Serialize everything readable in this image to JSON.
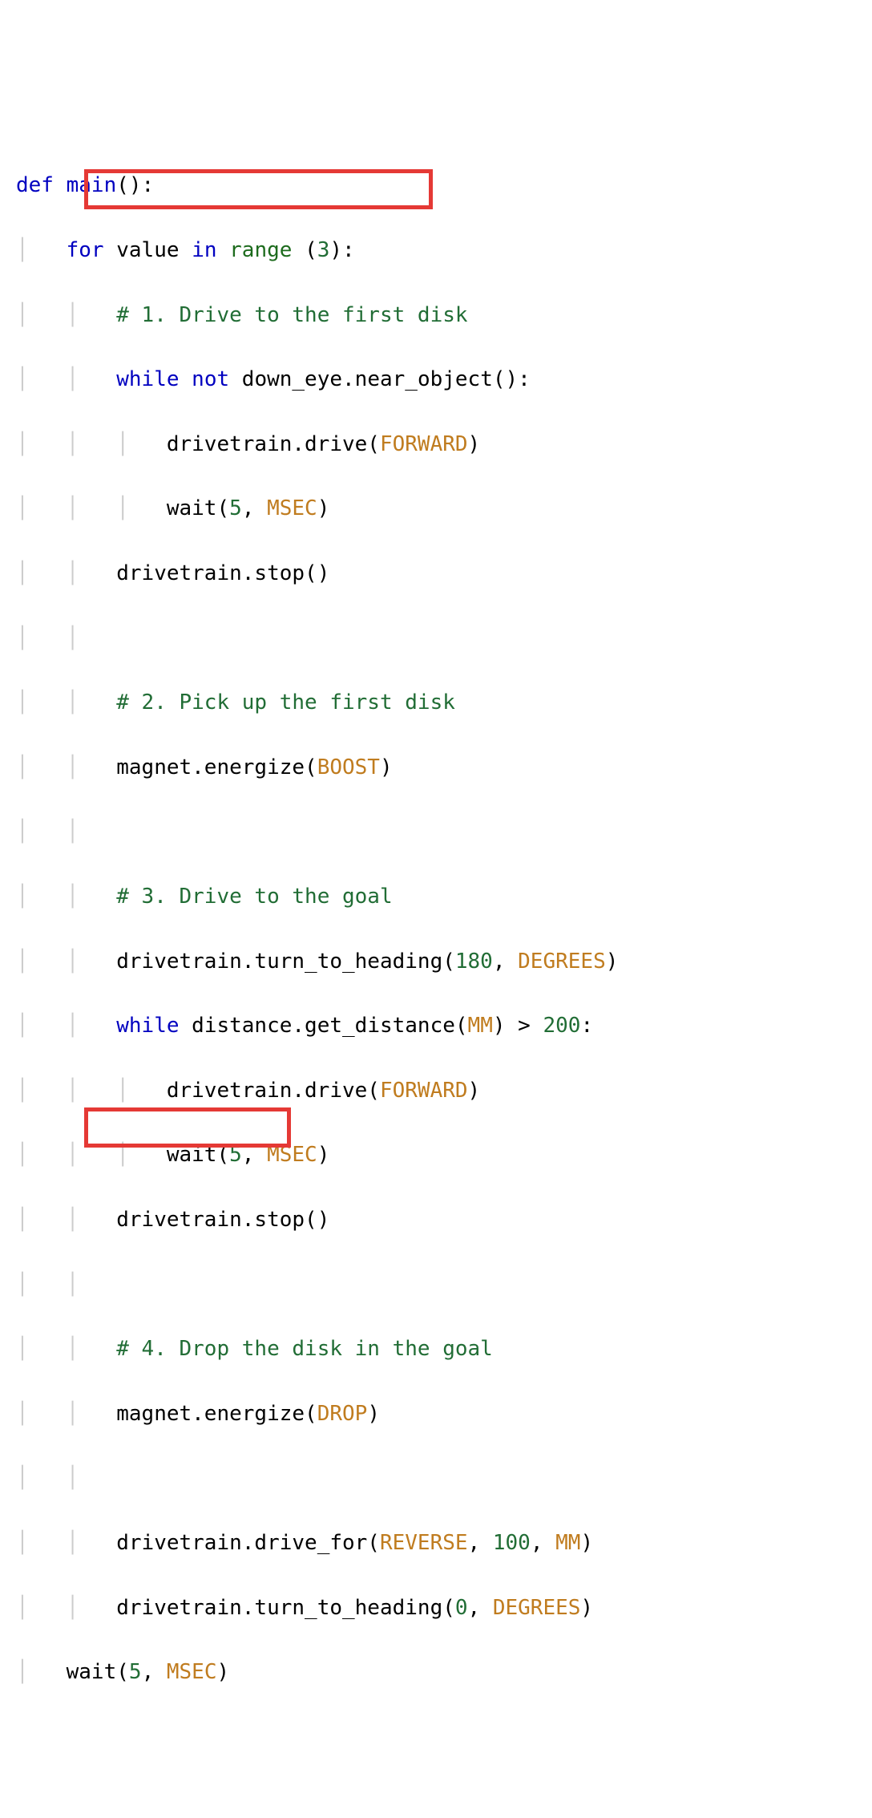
{
  "code": {
    "l0_def": "def",
    "l0_fn": "main",
    "l0_tail": "():",
    "l1_for": "for",
    "l1_var": "value",
    "l1_in": "in",
    "l1_range": "range",
    "l1_open": " (",
    "l1_n": "3",
    "l1_close": "):",
    "l2_comment": "# 1. Drive to the first disk",
    "l3_while": "while",
    "l3_not": "not",
    "l3_expr": " down_eye.near_object():",
    "l4_a": "drivetrain.drive(",
    "l4_c": "FORWARD",
    "l4_b": ")",
    "l5_a": "wait(",
    "l5_n": "5",
    "l5_sep": ", ",
    "l5_c": "MSEC",
    "l5_b": ")",
    "l6": "drivetrain.stop()",
    "l8_comment": "# 2. Pick up the first disk",
    "l9_a": "magnet.energize(",
    "l9_c": "BOOST",
    "l9_b": ")",
    "l11_comment": "# 3. Drive to the goal",
    "l12_a": "drivetrain.turn_to_heading(",
    "l12_n": "180",
    "l12_sep": ", ",
    "l12_c": "DEGREES",
    "l12_b": ")",
    "l13_while": "while",
    "l13_a": " distance.get_distance(",
    "l13_c": "MM",
    "l13_b": ") > ",
    "l13_n": "200",
    "l13_tail": ":",
    "l14_a": "drivetrain.drive(",
    "l14_c": "FORWARD",
    "l14_b": ")",
    "l15_a": "wait(",
    "l15_n": "5",
    "l15_sep": ", ",
    "l15_c": "MSEC",
    "l15_b": ")",
    "l16": "drivetrain.stop()",
    "l18_comment": "# 4. Drop the disk in the goal",
    "l19_a": "magnet.energize(",
    "l19_c": "DROP",
    "l19_b": ")",
    "l21_a": "drivetrain.drive_for(",
    "l21_c1": "REVERSE",
    "l21_sep1": ", ",
    "l21_n": "100",
    "l21_sep2": ", ",
    "l21_c2": "MM",
    "l21_b": ")",
    "l22_a": "drivetrain.turn_to_heading(",
    "l22_n": "0",
    "l22_sep": ", ",
    "l22_c": "DEGREES",
    "l22_b": ")",
    "l23_a": "wait(",
    "l23_n": "5",
    "l23_sep": ", ",
    "l23_c": "MSEC",
    "l23_b": ")"
  },
  "highlight": {
    "box1_desc": "for value in range(3):",
    "box2_desc": "wait(5, MSEC)"
  }
}
